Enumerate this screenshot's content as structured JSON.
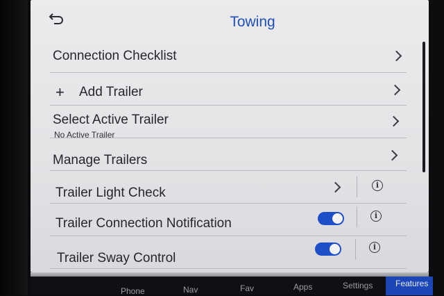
{
  "header": {
    "back_icon": "back-arrow-icon",
    "title": "Towing"
  },
  "rows": {
    "connection_checklist": "Connection Checklist",
    "add_trailer": "Add Trailer",
    "add_trailer_icon": "+",
    "select_active_trailer": "Select Active Trailer",
    "select_active_trailer_sub": "No Active Trailer",
    "manage_trailers": "Manage Trailers",
    "trailer_light_check": "Trailer Light Check",
    "trailer_connection_notification": "Trailer Connection Notification",
    "trailer_connection_notification_on": true,
    "trailer_sway_control": "Trailer Sway Control",
    "trailer_sway_control_on": true
  },
  "nav": {
    "phone": "Phone",
    "nav": "Nav",
    "fav": "Fav",
    "apps": "Apps",
    "settings": "Settings",
    "features": "Features",
    "active": "features"
  },
  "colors": {
    "title": "#1f4fb8",
    "toggle_on": "#1d4fc9",
    "nav_active": "#1c46b6"
  }
}
